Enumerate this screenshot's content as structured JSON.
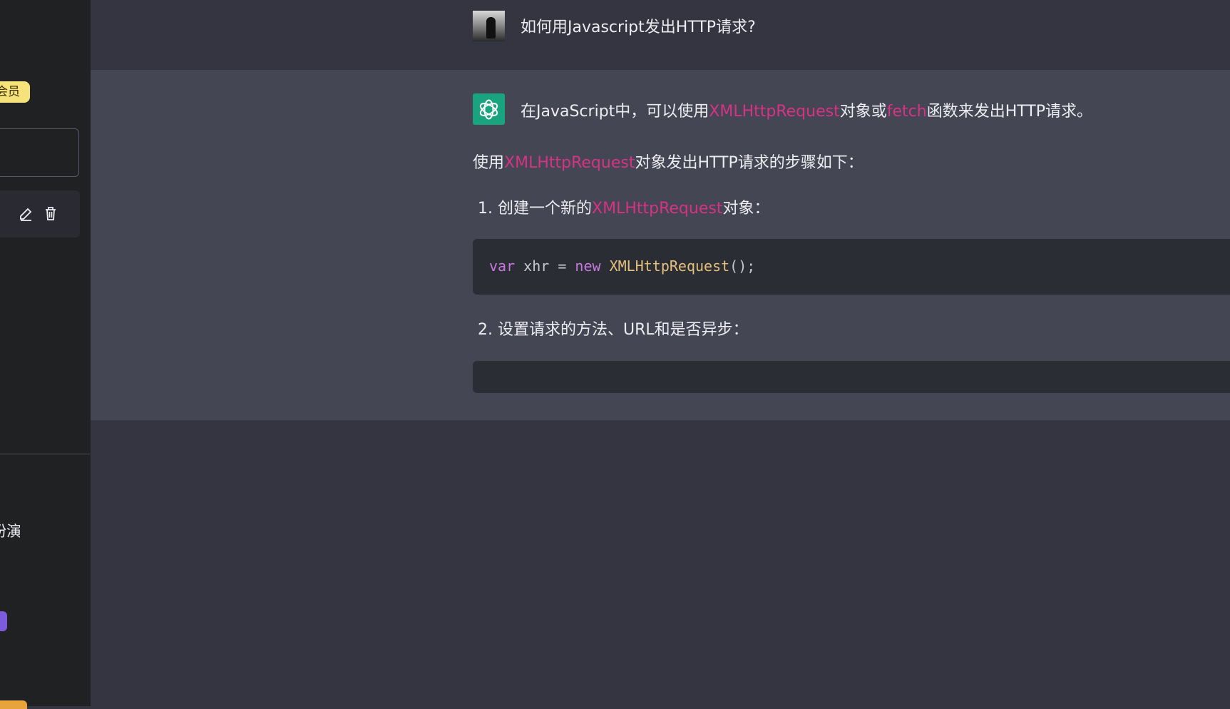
{
  "sidebar": {
    "vip_badge": "会员",
    "roleplay_item": "扮演"
  },
  "user_message": "如何用Javascript发出HTTP请求?",
  "assistant": {
    "p1": {
      "before": "在JavaScript中，可以使用",
      "code1": "XMLHttpRequest",
      "mid": "对象或",
      "code2": "fetch",
      "after": "函数来发出HTTP请求。"
    },
    "p2": {
      "before": "使用",
      "code": "XMLHttpRequest",
      "after": "对象发出HTTP请求的步骤如下："
    },
    "step1": {
      "number": "1.",
      "before": "创建一个新的",
      "code": "XMLHttpRequest",
      "after": "对象："
    },
    "code_block_1": {
      "kw_var": "var",
      "ident": " xhr = ",
      "kw_new": "new",
      "cls": "XMLHttpRequest",
      "tail": "();"
    },
    "step2": {
      "number": "2.",
      "text": "设置请求的方法、URL和是否异步："
    }
  },
  "colors": {
    "sidebar_bg": "#202123",
    "user_row_bg": "#343541",
    "assistant_row_bg": "#444654",
    "inline_code": "#d63384",
    "code_block_bg": "#2b2d35",
    "ai_avatar_bg": "#19a37f",
    "vip_badge_bg": "#f6e27a"
  }
}
